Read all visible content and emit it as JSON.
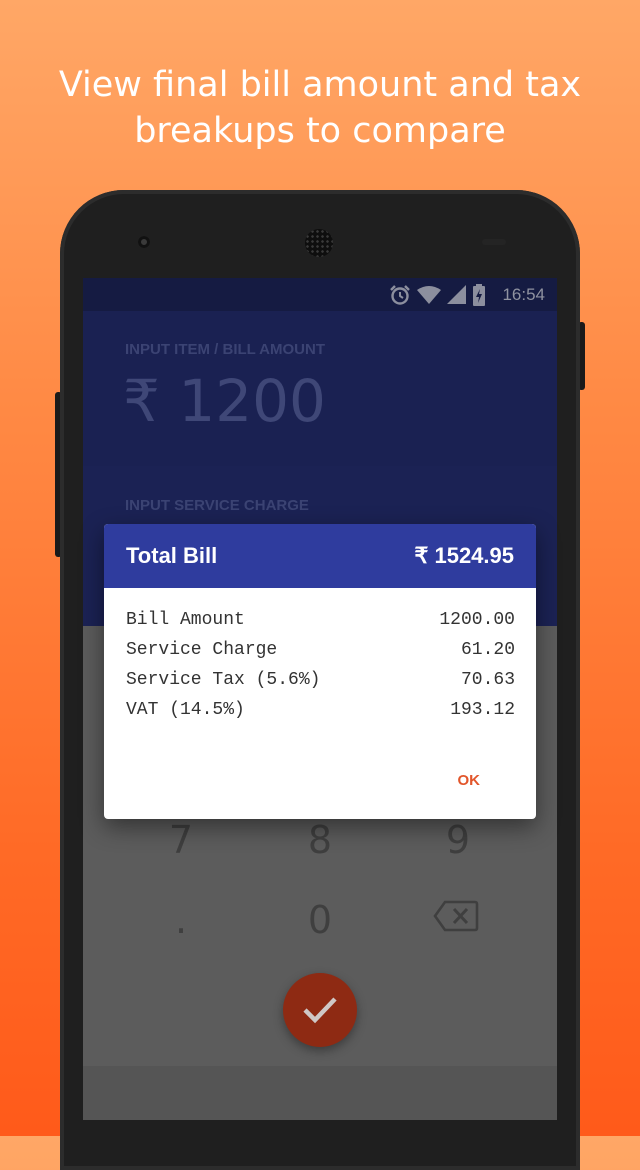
{
  "promo": {
    "line1": "View final bill amount and tax",
    "line2": "breakups to compare"
  },
  "status_bar": {
    "time": "16:54",
    "icons": [
      "alarm-icon",
      "wifi-icon",
      "signal-icon",
      "battery-charging-icon"
    ]
  },
  "input_panel": {
    "label": "INPUT ITEM / BILL AMOUNT",
    "amount": "₹ 1200"
  },
  "service_panel": {
    "label": "INPUT SERVICE CHARGE"
  },
  "keypad": {
    "k7": "7",
    "k8": "8",
    "k9": "9",
    "kdot": ".",
    "k0": "0",
    "backspace_icon": "backspace-icon",
    "submit_icon": "check-icon"
  },
  "dialog": {
    "title": "Total Bill",
    "total": "₹ 1524.95",
    "rows": [
      {
        "label": "Bill Amount",
        "value": "1200.00"
      },
      {
        "label": "Service Charge",
        "value": "61.20"
      },
      {
        "label": "Service Tax (5.6%)",
        "value": "70.63"
      },
      {
        "label": "VAT (14.5%)",
        "value": "193.12"
      }
    ],
    "ok_label": "OK"
  },
  "colors": {
    "header_blue": "#2f3c9e",
    "accent_orange": "#e2562b",
    "background_orange": "#ff7a35"
  }
}
